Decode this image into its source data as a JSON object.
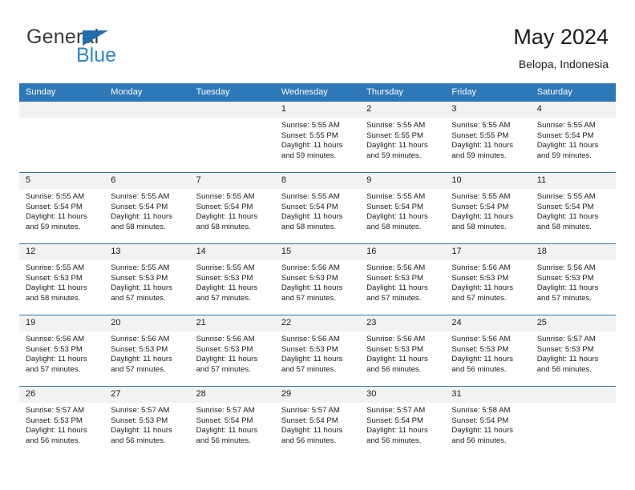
{
  "brand": {
    "name_top": "General",
    "name_bottom": "Blue",
    "flag_icon": "triangle-flag-icon",
    "accent_color": "#2a87d0",
    "header_color": "#2e78b8"
  },
  "header": {
    "title": "May 2024",
    "location": "Belopa, Indonesia"
  },
  "calendar": {
    "weekdays": [
      "Sunday",
      "Monday",
      "Tuesday",
      "Wednesday",
      "Thursday",
      "Friday",
      "Saturday"
    ],
    "labels": {
      "sunrise": "Sunrise:",
      "sunset": "Sunset:",
      "daylight": "Daylight:"
    },
    "weeks": [
      [
        {
          "day": "",
          "empty": true
        },
        {
          "day": "",
          "empty": true
        },
        {
          "day": "",
          "empty": true
        },
        {
          "day": "1",
          "sunrise": "Sunrise: 5:55 AM",
          "sunset": "Sunset: 5:55 PM",
          "daylight1": "Daylight: 11 hours",
          "daylight2": "and 59 minutes."
        },
        {
          "day": "2",
          "sunrise": "Sunrise: 5:55 AM",
          "sunset": "Sunset: 5:55 PM",
          "daylight1": "Daylight: 11 hours",
          "daylight2": "and 59 minutes."
        },
        {
          "day": "3",
          "sunrise": "Sunrise: 5:55 AM",
          "sunset": "Sunset: 5:55 PM",
          "daylight1": "Daylight: 11 hours",
          "daylight2": "and 59 minutes."
        },
        {
          "day": "4",
          "sunrise": "Sunrise: 5:55 AM",
          "sunset": "Sunset: 5:54 PM",
          "daylight1": "Daylight: 11 hours",
          "daylight2": "and 59 minutes."
        }
      ],
      [
        {
          "day": "5",
          "sunrise": "Sunrise: 5:55 AM",
          "sunset": "Sunset: 5:54 PM",
          "daylight1": "Daylight: 11 hours",
          "daylight2": "and 59 minutes."
        },
        {
          "day": "6",
          "sunrise": "Sunrise: 5:55 AM",
          "sunset": "Sunset: 5:54 PM",
          "daylight1": "Daylight: 11 hours",
          "daylight2": "and 58 minutes."
        },
        {
          "day": "7",
          "sunrise": "Sunrise: 5:55 AM",
          "sunset": "Sunset: 5:54 PM",
          "daylight1": "Daylight: 11 hours",
          "daylight2": "and 58 minutes."
        },
        {
          "day": "8",
          "sunrise": "Sunrise: 5:55 AM",
          "sunset": "Sunset: 5:54 PM",
          "daylight1": "Daylight: 11 hours",
          "daylight2": "and 58 minutes."
        },
        {
          "day": "9",
          "sunrise": "Sunrise: 5:55 AM",
          "sunset": "Sunset: 5:54 PM",
          "daylight1": "Daylight: 11 hours",
          "daylight2": "and 58 minutes."
        },
        {
          "day": "10",
          "sunrise": "Sunrise: 5:55 AM",
          "sunset": "Sunset: 5:54 PM",
          "daylight1": "Daylight: 11 hours",
          "daylight2": "and 58 minutes."
        },
        {
          "day": "11",
          "sunrise": "Sunrise: 5:55 AM",
          "sunset": "Sunset: 5:54 PM",
          "daylight1": "Daylight: 11 hours",
          "daylight2": "and 58 minutes."
        }
      ],
      [
        {
          "day": "12",
          "sunrise": "Sunrise: 5:55 AM",
          "sunset": "Sunset: 5:53 PM",
          "daylight1": "Daylight: 11 hours",
          "daylight2": "and 58 minutes."
        },
        {
          "day": "13",
          "sunrise": "Sunrise: 5:55 AM",
          "sunset": "Sunset: 5:53 PM",
          "daylight1": "Daylight: 11 hours",
          "daylight2": "and 57 minutes."
        },
        {
          "day": "14",
          "sunrise": "Sunrise: 5:55 AM",
          "sunset": "Sunset: 5:53 PM",
          "daylight1": "Daylight: 11 hours",
          "daylight2": "and 57 minutes."
        },
        {
          "day": "15",
          "sunrise": "Sunrise: 5:56 AM",
          "sunset": "Sunset: 5:53 PM",
          "daylight1": "Daylight: 11 hours",
          "daylight2": "and 57 minutes."
        },
        {
          "day": "16",
          "sunrise": "Sunrise: 5:56 AM",
          "sunset": "Sunset: 5:53 PM",
          "daylight1": "Daylight: 11 hours",
          "daylight2": "and 57 minutes."
        },
        {
          "day": "17",
          "sunrise": "Sunrise: 5:56 AM",
          "sunset": "Sunset: 5:53 PM",
          "daylight1": "Daylight: 11 hours",
          "daylight2": "and 57 minutes."
        },
        {
          "day": "18",
          "sunrise": "Sunrise: 5:56 AM",
          "sunset": "Sunset: 5:53 PM",
          "daylight1": "Daylight: 11 hours",
          "daylight2": "and 57 minutes."
        }
      ],
      [
        {
          "day": "19",
          "sunrise": "Sunrise: 5:56 AM",
          "sunset": "Sunset: 5:53 PM",
          "daylight1": "Daylight: 11 hours",
          "daylight2": "and 57 minutes."
        },
        {
          "day": "20",
          "sunrise": "Sunrise: 5:56 AM",
          "sunset": "Sunset: 5:53 PM",
          "daylight1": "Daylight: 11 hours",
          "daylight2": "and 57 minutes."
        },
        {
          "day": "21",
          "sunrise": "Sunrise: 5:56 AM",
          "sunset": "Sunset: 5:53 PM",
          "daylight1": "Daylight: 11 hours",
          "daylight2": "and 57 minutes."
        },
        {
          "day": "22",
          "sunrise": "Sunrise: 5:56 AM",
          "sunset": "Sunset: 5:53 PM",
          "daylight1": "Daylight: 11 hours",
          "daylight2": "and 57 minutes."
        },
        {
          "day": "23",
          "sunrise": "Sunrise: 5:56 AM",
          "sunset": "Sunset: 5:53 PM",
          "daylight1": "Daylight: 11 hours",
          "daylight2": "and 56 minutes."
        },
        {
          "day": "24",
          "sunrise": "Sunrise: 5:56 AM",
          "sunset": "Sunset: 5:53 PM",
          "daylight1": "Daylight: 11 hours",
          "daylight2": "and 56 minutes."
        },
        {
          "day": "25",
          "sunrise": "Sunrise: 5:57 AM",
          "sunset": "Sunset: 5:53 PM",
          "daylight1": "Daylight: 11 hours",
          "daylight2": "and 56 minutes."
        }
      ],
      [
        {
          "day": "26",
          "sunrise": "Sunrise: 5:57 AM",
          "sunset": "Sunset: 5:53 PM",
          "daylight1": "Daylight: 11 hours",
          "daylight2": "and 56 minutes."
        },
        {
          "day": "27",
          "sunrise": "Sunrise: 5:57 AM",
          "sunset": "Sunset: 5:53 PM",
          "daylight1": "Daylight: 11 hours",
          "daylight2": "and 56 minutes."
        },
        {
          "day": "28",
          "sunrise": "Sunrise: 5:57 AM",
          "sunset": "Sunset: 5:54 PM",
          "daylight1": "Daylight: 11 hours",
          "daylight2": "and 56 minutes."
        },
        {
          "day": "29",
          "sunrise": "Sunrise: 5:57 AM",
          "sunset": "Sunset: 5:54 PM",
          "daylight1": "Daylight: 11 hours",
          "daylight2": "and 56 minutes."
        },
        {
          "day": "30",
          "sunrise": "Sunrise: 5:57 AM",
          "sunset": "Sunset: 5:54 PM",
          "daylight1": "Daylight: 11 hours",
          "daylight2": "and 56 minutes."
        },
        {
          "day": "31",
          "sunrise": "Sunrise: 5:58 AM",
          "sunset": "Sunset: 5:54 PM",
          "daylight1": "Daylight: 11 hours",
          "daylight2": "and 56 minutes."
        },
        {
          "day": "",
          "empty": true
        }
      ]
    ]
  }
}
